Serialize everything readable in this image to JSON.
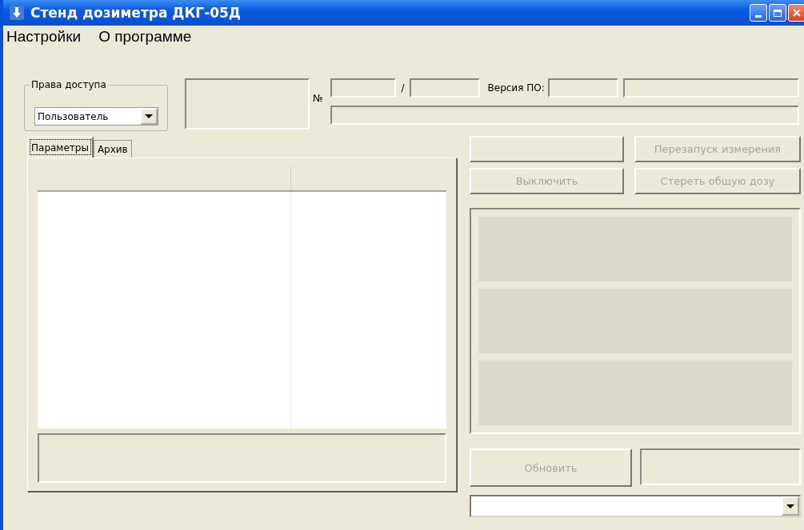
{
  "window": {
    "title": "Стенд дозиметра ДКГ-05Д"
  },
  "menu": [
    "Настройки",
    "О программе"
  ],
  "access": {
    "label": "Права доступа",
    "value": "Пользователь"
  },
  "device": {
    "number_label": "№",
    "separator": "/",
    "version_label": "Версия ПО:"
  },
  "tabs": [
    {
      "label": "Параметры",
      "selected": true
    },
    {
      "label": "Архив",
      "selected": false
    }
  ],
  "buttons": [
    {
      "label": "Перезапуск измерения",
      "disabled": true
    },
    {
      "label": "Выключить",
      "disabled": true
    },
    {
      "label": "Стереть общую дозу",
      "disabled": true
    }
  ],
  "refresh_button": {
    "label": "Обновить",
    "disabled": true
  }
}
